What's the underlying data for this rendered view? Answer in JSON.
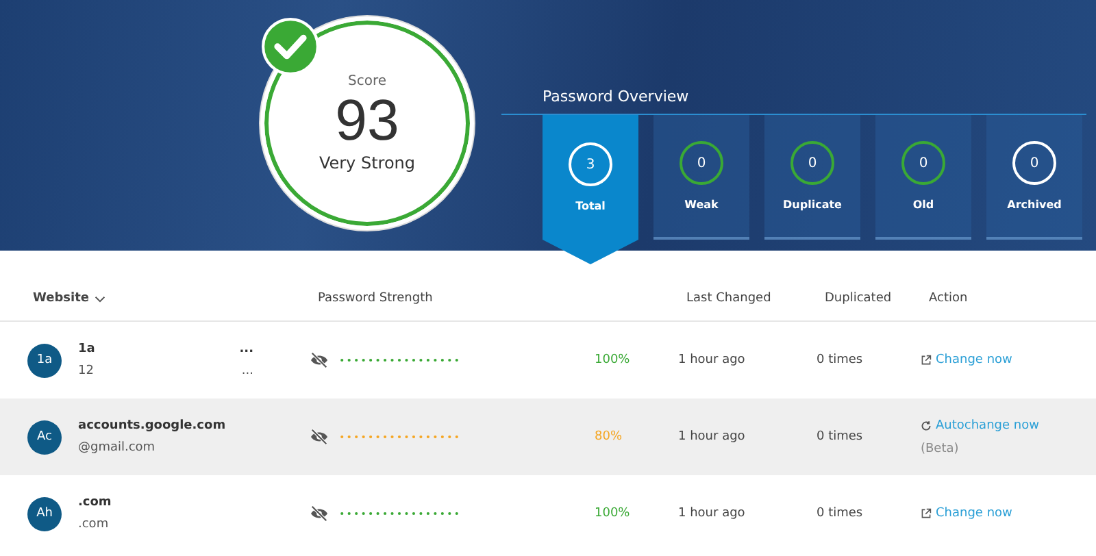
{
  "score": {
    "label": "Score",
    "value": "93",
    "rating": "Very Strong"
  },
  "overview": {
    "title": "Password Overview",
    "tiles": [
      {
        "count": "3",
        "label": "Total",
        "selected": true,
        "color": "#ffffff"
      },
      {
        "count": "0",
        "label": "Weak",
        "selected": false,
        "color": "#3aa935"
      },
      {
        "count": "0",
        "label": "Duplicate",
        "selected": false,
        "color": "#3aa935"
      },
      {
        "count": "0",
        "label": "Old",
        "selected": false,
        "color": "#3aa935"
      },
      {
        "count": "0",
        "label": "Archived",
        "selected": false,
        "color": "#ffffff"
      }
    ]
  },
  "table": {
    "columns": [
      "Website",
      "Password Strength",
      "Last Changed",
      "Duplicated",
      "Action"
    ],
    "rows": [
      {
        "avatar": "1a",
        "name": [
          "1a",
          "..."
        ],
        "subtitle": [
          "12",
          "..."
        ],
        "color": "#3aa935",
        "strength": "100%",
        "last_changed": "1 hour ago",
        "duplicated": "0 times",
        "action": {
          "kind": "change",
          "label": "Change now"
        },
        "selected": false
      },
      {
        "avatar": "Ac",
        "name": [
          "accounts.google.com"
        ],
        "subtitle": [
          "@gmail.com"
        ],
        "color": "#f5a623",
        "strength": "80%",
        "last_changed": "1 hour ago",
        "duplicated": "0 times",
        "action": {
          "kind": "autochange",
          "label": "Autochange now",
          "note": "(Beta)"
        },
        "selected": true
      },
      {
        "avatar": "Ah",
        "name": [
          ".com"
        ],
        "subtitle": [
          ".com"
        ],
        "color": "#3aa935",
        "strength": "100%",
        "last_changed": "1 hour ago",
        "duplicated": "0 times",
        "action": {
          "kind": "change",
          "label": "Change now"
        },
        "selected": false
      }
    ]
  }
}
